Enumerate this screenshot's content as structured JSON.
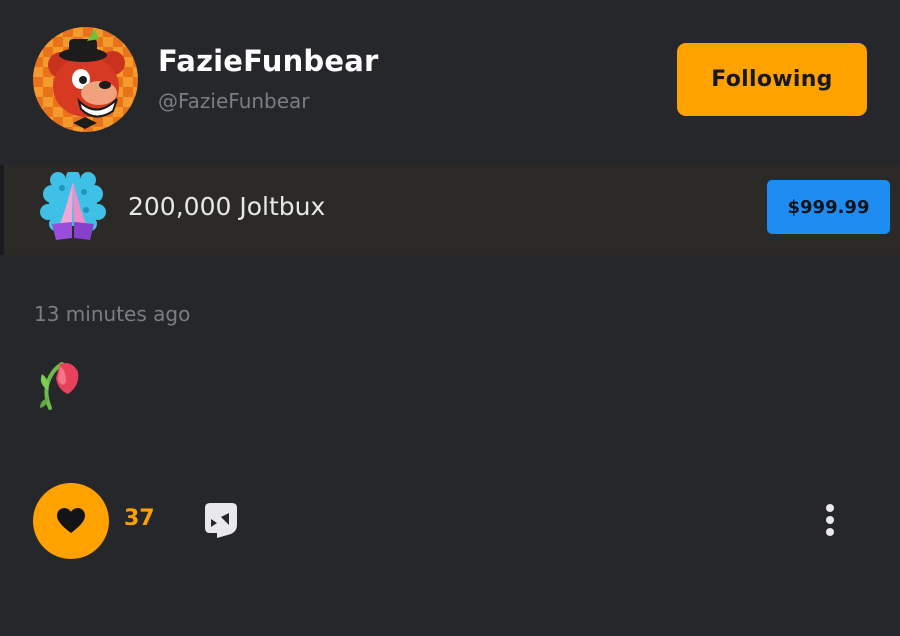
{
  "post": {
    "author": {
      "display_name": "FazieFunbear",
      "handle": "@FazieFunbear",
      "avatar_icon": "cartoon-bear-avatar"
    },
    "follow_button_label": "Following",
    "purchase": {
      "icon": "praying-hands-icon",
      "product": "200,000 Joltbux",
      "price": "$999.99"
    },
    "timestamp": "13 minutes ago",
    "body_emoji": "wilted-rose-emoji",
    "like_count": "37"
  },
  "colors": {
    "background": "#26272b",
    "accent": "#ffa200",
    "price_button": "#1f8cf2",
    "secondary_text": "#7c7d82"
  }
}
